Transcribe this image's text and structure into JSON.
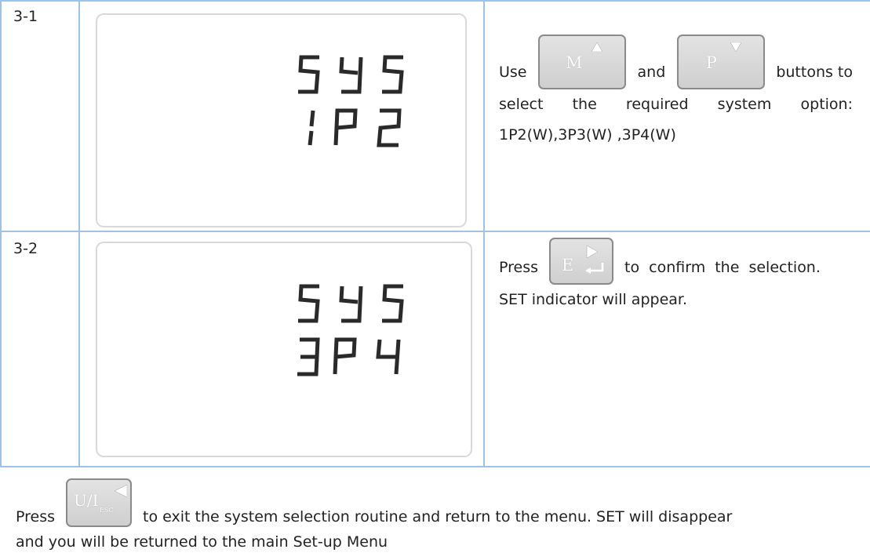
{
  "rows": [
    {
      "step": "3-1",
      "display": {
        "line1": "SYS",
        "line2": "1P2"
      },
      "desc": {
        "word_use": "Use",
        "word_and": "and",
        "word_buttons_to": "buttons to",
        "line2": [
          "select",
          "the",
          "required",
          "system",
          "option:"
        ],
        "line3": "1P2(W),3P3(W) ,3P4(W)"
      },
      "buttons": [
        {
          "name": "M",
          "icon": "up-triangle-icon"
        },
        {
          "name": "P",
          "icon": "down-triangle-icon"
        }
      ]
    },
    {
      "step": "3-2",
      "display": {
        "line1": "SYS",
        "line2": "3P4"
      },
      "desc": {
        "word_press": "Press",
        "after_button": "to confirm the selection.",
        "line2": "SET indicator will appear."
      },
      "buttons": [
        {
          "name": "E",
          "icon": "enter-arrow-icon"
        }
      ]
    }
  ],
  "footer": {
    "word_press": "Press",
    "after_button": "to exit the system selection routine and return to the menu. SET will disappear",
    "line2": "and you will be returned to the main Set-up Menu",
    "button": {
      "name": "U/I",
      "subscript": "ESC",
      "icon": "left-triangle-icon"
    }
  }
}
